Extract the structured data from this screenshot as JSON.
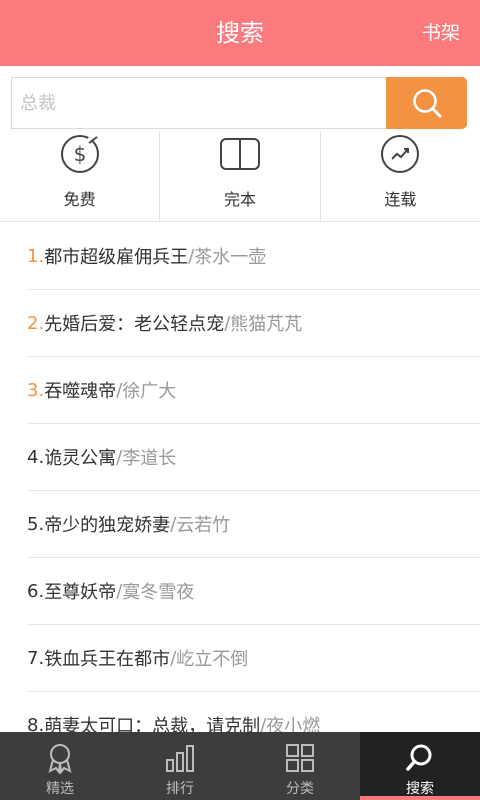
{
  "header": {
    "title": "搜索",
    "shelf_label": "书架"
  },
  "search": {
    "placeholder": "总裁",
    "button_icon": "search-icon"
  },
  "categories": [
    {
      "label": "免费",
      "icon": "dollar-circle-icon"
    },
    {
      "label": "完本",
      "icon": "open-book-icon"
    },
    {
      "label": "连载",
      "icon": "trend-circle-icon"
    }
  ],
  "ranking": [
    {
      "num": "1.",
      "title": "都市超级雇佣兵王",
      "sep": " / ",
      "author": "茶水一壶",
      "highlight": true
    },
    {
      "num": "2.",
      "title": "先婚后爱：老公轻点宠",
      "sep": " / ",
      "author": "熊猫芃芃",
      "highlight": true
    },
    {
      "num": "3.",
      "title": "吞噬魂帝",
      "sep": " / ",
      "author": "徐广大",
      "highlight": true
    },
    {
      "num": "4.",
      "title": "诡灵公寓",
      "sep": " / ",
      "author": "李道长",
      "highlight": false
    },
    {
      "num": "5.",
      "title": "帝少的独宠娇妻",
      "sep": " / ",
      "author": "云若竹",
      "highlight": false
    },
    {
      "num": "6.",
      "title": "至尊妖帝",
      "sep": " / ",
      "author": "寞冬雪夜",
      "highlight": false
    },
    {
      "num": "7.",
      "title": "铁血兵王在都市",
      "sep": " / ",
      "author": "屹立不倒",
      "highlight": false
    },
    {
      "num": "8.",
      "title": "萌妻太可口：总裁，请克制",
      "sep": " / ",
      "author": "夜小燃",
      "highlight": false
    }
  ],
  "tabs": [
    {
      "label": "精选",
      "icon": "award-ribbon-icon",
      "active": false
    },
    {
      "label": "排行",
      "icon": "bar-chart-icon",
      "active": false
    },
    {
      "label": "分类",
      "icon": "grid-icon",
      "active": false
    },
    {
      "label": "搜索",
      "icon": "search-icon",
      "active": true
    }
  ],
  "colors": {
    "header": "#fb7a7c",
    "accent": "#f39243",
    "tabbar": "#3d3d3d"
  }
}
